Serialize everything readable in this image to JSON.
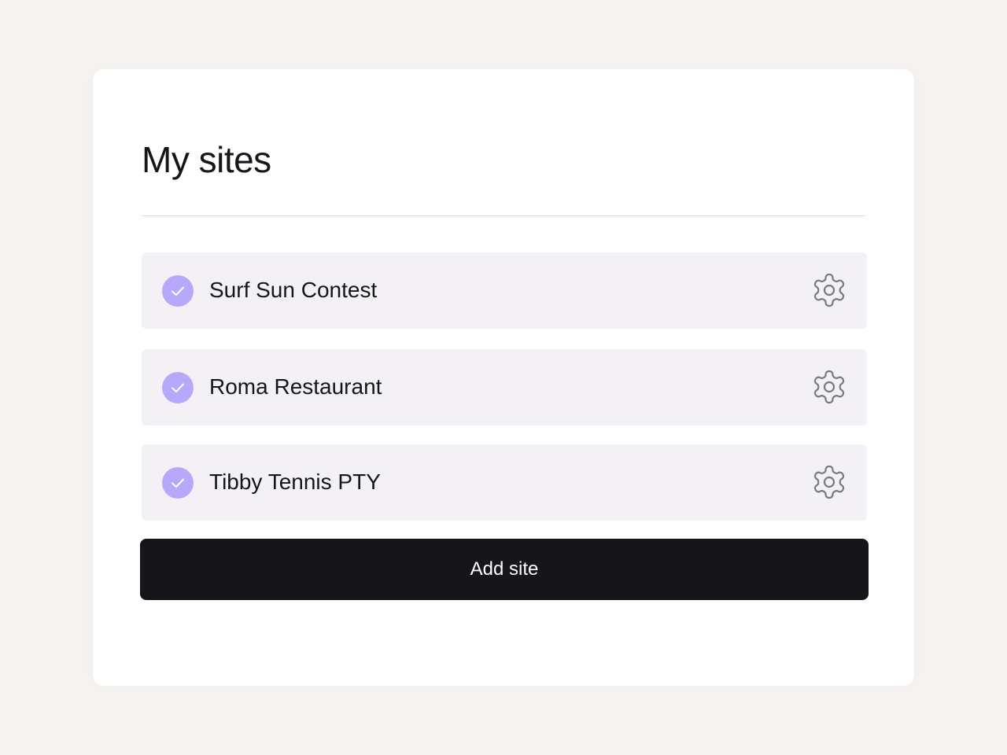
{
  "page": {
    "title": "My sites"
  },
  "sites": [
    {
      "name": "Surf Sun Contest",
      "status_icon": "check-circle-icon",
      "settings_icon": "gear-icon"
    },
    {
      "name": "Roma Restaurant",
      "status_icon": "check-circle-icon",
      "settings_icon": "gear-icon"
    },
    {
      "name": "Tibby Tennis PTY",
      "status_icon": "check-circle-icon",
      "settings_icon": "gear-icon"
    }
  ],
  "actions": {
    "add_site_label": "Add site"
  },
  "colors": {
    "background": "#f7f4f2",
    "card": "#ffffff",
    "row": "#f3f1f5",
    "accent": "#b8a8fb",
    "button": "#16151a",
    "text": "#16151a",
    "icon": "#7a7880"
  }
}
